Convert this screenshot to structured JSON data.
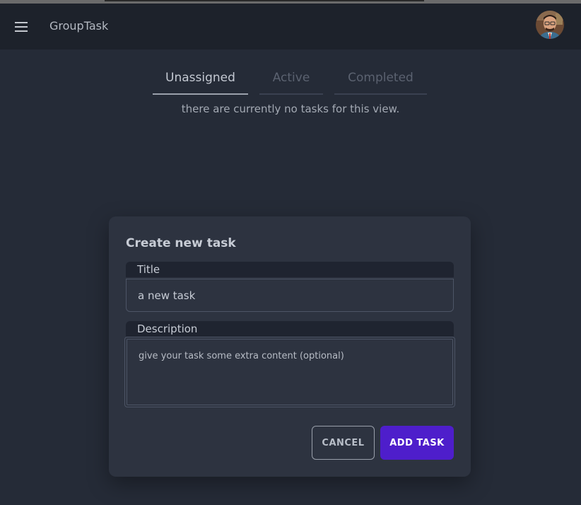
{
  "header": {
    "app_title": "GroupTask",
    "menu_icon": "hamburger-menu-icon",
    "avatar_icon": "user-avatar"
  },
  "tabs": [
    {
      "label": "Unassigned",
      "active": true
    },
    {
      "label": "Active",
      "active": false
    },
    {
      "label": "Completed",
      "active": false
    }
  ],
  "empty_message": "there are currently no tasks for this view.",
  "dialog": {
    "title": "Create new task",
    "title_field": {
      "label": "Title",
      "value": "a new task"
    },
    "description_field": {
      "label": "Description",
      "placeholder": "give your task some extra content (optional)"
    },
    "cancel_label": "CANCEL",
    "add_label": "ADD TASK"
  },
  "colors": {
    "accent": "#4e1ecb",
    "background": "#252b37",
    "topbar": "#1d222b",
    "dialog": "#2d3340"
  }
}
